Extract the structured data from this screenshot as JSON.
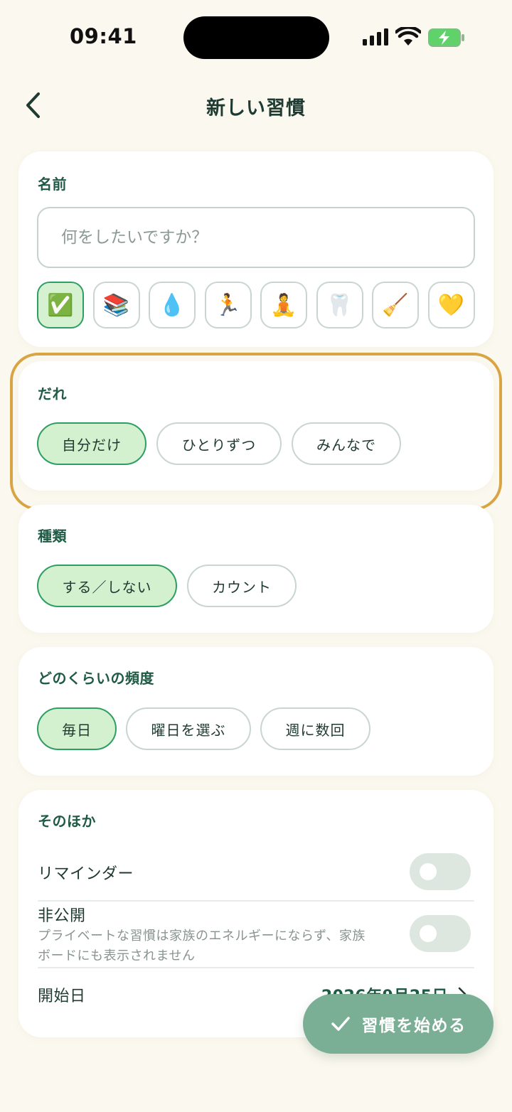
{
  "status_bar": {
    "time": "09:41"
  },
  "header": {
    "title": "新しい習慣"
  },
  "name_section": {
    "title": "名前",
    "placeholder": "何をしたいですか？",
    "emojis": [
      "✅",
      "📚",
      "💧",
      "🏃",
      "🧘",
      "🦷",
      "🧹",
      "💛"
    ],
    "selected_index": 0
  },
  "who_section": {
    "title": "だれ",
    "options": [
      "自分だけ",
      "ひとりずつ",
      "みんなで"
    ],
    "selected": "自分だけ"
  },
  "type_section": {
    "title": "種類",
    "options": [
      "する／しない",
      "カウント"
    ],
    "selected": "する／しない"
  },
  "frequency_section": {
    "title": "どのくらいの頻度",
    "options": [
      "毎日",
      "曜日を選ぶ",
      "週に数回"
    ],
    "selected": "毎日"
  },
  "other_section": {
    "title": "そのほか",
    "reminder_label": "リマインダー",
    "reminder_on": false,
    "private_label": "非公開",
    "private_sub_line1": "プライベートな習慣は家族のエネルギーにならず、家族",
    "private_sub_line2": "ボードにも表示されません",
    "private_on": false,
    "start_date_label": "開始日",
    "start_date_value": "2026年9月25日"
  },
  "fab": {
    "label": "習慣を始める"
  },
  "colors": {
    "background": "#FBF8EF",
    "accent": "#1E5A44",
    "selected_fill": "#D3F0CF",
    "selected_border": "#2E9E62",
    "highlight": "#D9A443",
    "fab": "#7BAF95"
  }
}
